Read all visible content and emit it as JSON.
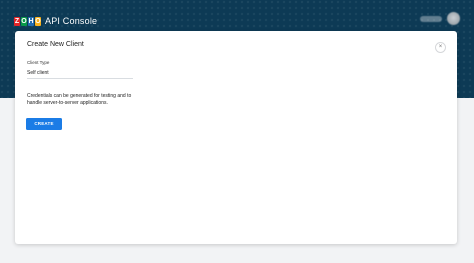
{
  "header": {
    "logo_letters": [
      "Z",
      "O",
      "H",
      "O"
    ],
    "logo_colors": [
      "#e42527",
      "#089949",
      "#226db4",
      "#f9b21d"
    ],
    "app_title": "API Console"
  },
  "modal": {
    "title": "Create New Client",
    "close_icon": "×",
    "client_type_label": "Client Type",
    "client_type_value": "Self client",
    "description": "Credentials can be generated for testing and to handle server-to-server applications.",
    "create_button": "CREATE"
  },
  "colors": {
    "header_bg": "#0d3a55",
    "primary": "#1b7ce6"
  }
}
